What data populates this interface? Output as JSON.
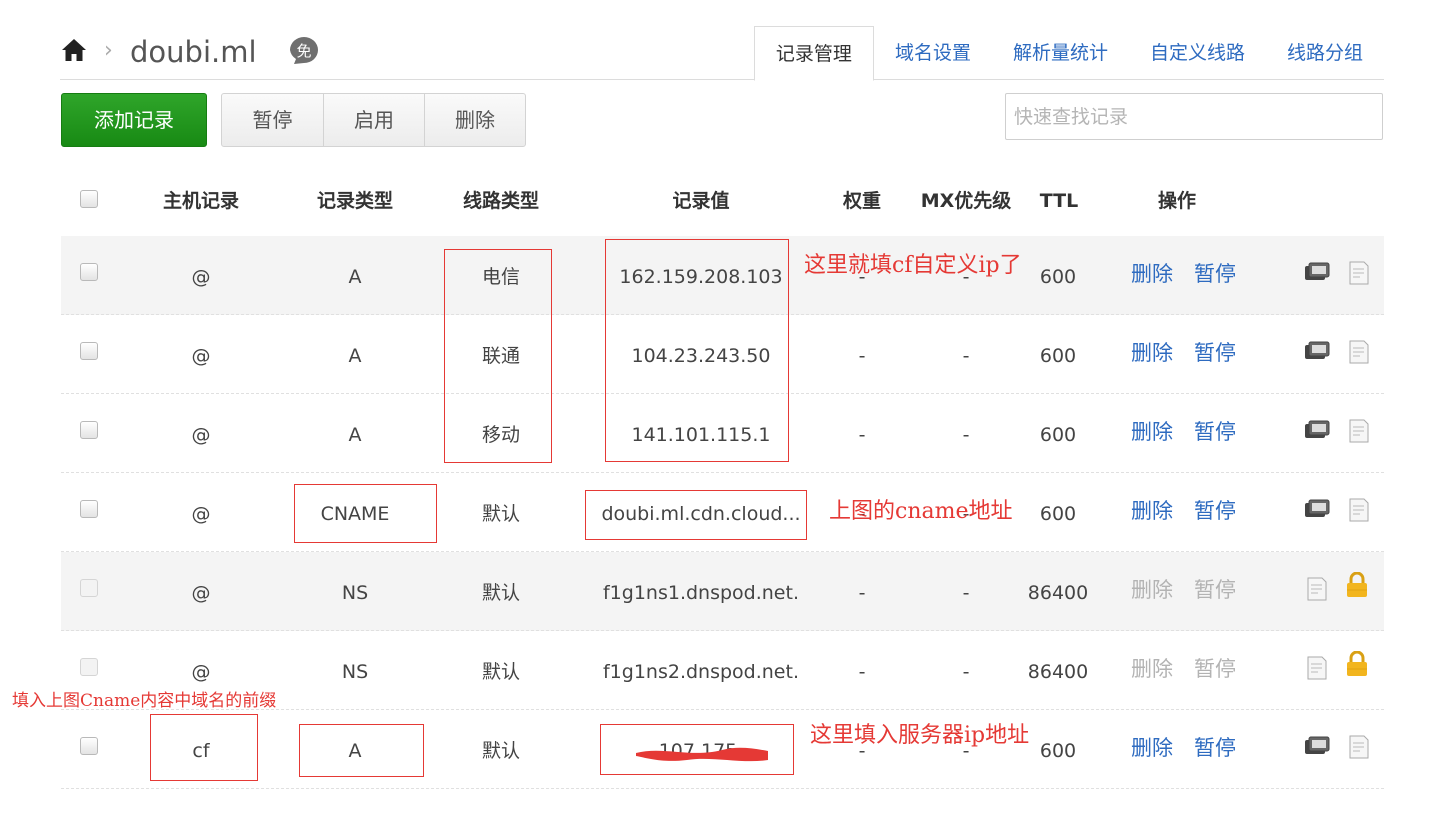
{
  "header": {
    "domain": "doubi.ml",
    "breadcrumb_separator": "›",
    "free_badge_text": "免",
    "tabs": [
      "记录管理",
      "域名设置",
      "解析量统计",
      "自定义线路",
      "线路分组"
    ],
    "active_tab": "记录管理"
  },
  "toolbar": {
    "add_label": "添加记录",
    "pause_label": "暂停",
    "enable_label": "启用",
    "delete_label": "删除",
    "search_placeholder": "快速查找记录"
  },
  "table": {
    "columns": {
      "host": "主机记录",
      "type": "记录类型",
      "line": "线路类型",
      "value": "记录值",
      "weight": "权重",
      "mx": "MX优先级",
      "ttl": "TTL",
      "ops": "操作"
    },
    "rows": [
      {
        "host": "@",
        "type": "A",
        "line": "电信",
        "value": "162.159.208.103",
        "weight": "-",
        "mx": "-",
        "ttl": "600",
        "delete": "删除",
        "pause": "暂停"
      },
      {
        "host": "@",
        "type": "A",
        "line": "联通",
        "value": "104.23.243.50",
        "weight": "-",
        "mx": "-",
        "ttl": "600",
        "delete": "删除",
        "pause": "暂停"
      },
      {
        "host": "@",
        "type": "A",
        "line": "移动",
        "value": "141.101.115.1",
        "weight": "-",
        "mx": "-",
        "ttl": "600",
        "delete": "删除",
        "pause": "暂停"
      },
      {
        "host": "@",
        "type": "CNAME",
        "line": "默认",
        "value": "doubi.ml.cdn.cloud...",
        "weight": "-",
        "mx": "-",
        "ttl": "600",
        "delete": "删除",
        "pause": "暂停"
      },
      {
        "host": "@",
        "type": "NS",
        "line": "默认",
        "value": "f1g1ns1.dnspod.net.",
        "weight": "-",
        "mx": "-",
        "ttl": "86400",
        "delete": "删除",
        "pause": "暂停",
        "locked": true
      },
      {
        "host": "@",
        "type": "NS",
        "line": "默认",
        "value": "f1g1ns2.dnspod.net.",
        "weight": "-",
        "mx": "-",
        "ttl": "86400",
        "delete": "删除",
        "pause": "暂停",
        "locked": true
      },
      {
        "host": "cf",
        "type": "A",
        "line": "默认",
        "value": "107.175.",
        "weight": "-",
        "mx": "-",
        "ttl": "600",
        "delete": "删除",
        "pause": "暂停"
      }
    ]
  },
  "annotations": {
    "note_cf_ip": "这里就填cf自定义ip了",
    "note_cname": "上图的cname地址",
    "note_prefix": "填入上图Cname内容中域名的前缀",
    "note_server_ip": "这里填入服务器ip地址",
    "color": "#e53935"
  },
  "colors": {
    "accent_link": "#2e6bc0",
    "add_button": "#1f9a1a",
    "lock_icon": "#f2b51e"
  },
  "icons": [
    "home-icon",
    "free-badge-icon",
    "copy-icon",
    "note-icon",
    "lock-icon"
  ]
}
